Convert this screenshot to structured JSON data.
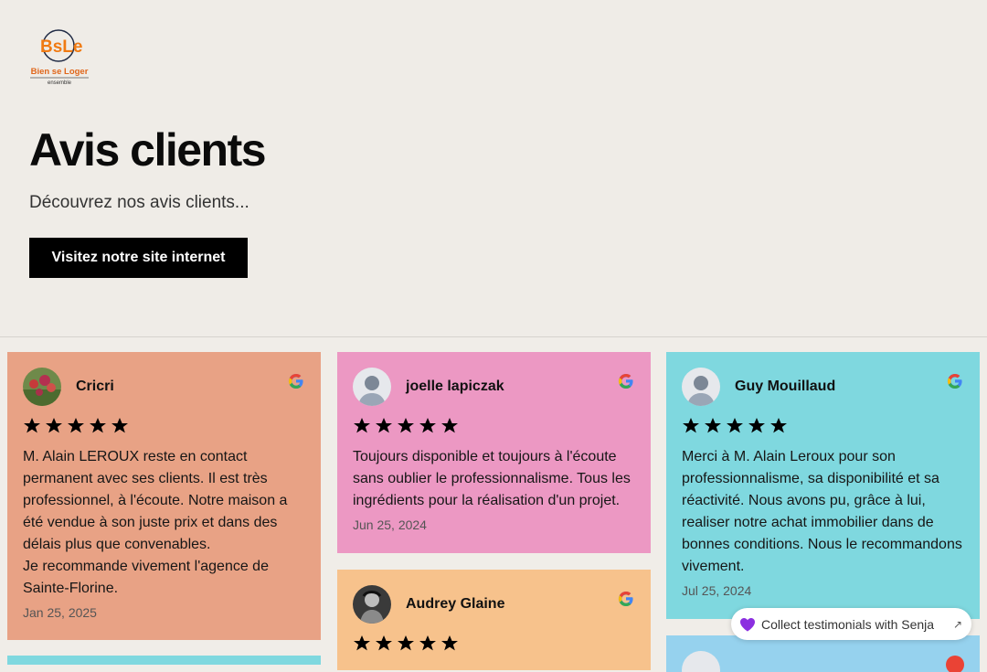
{
  "header": {
    "logo_text": "BsLe",
    "logo_line1": "Bien se Loger",
    "logo_line2": "ensemble",
    "title": "Avis clients",
    "subtitle": "Découvrez nos avis clients...",
    "cta_label": "Visitez notre site internet"
  },
  "reviews": [
    {
      "name": "Cricri",
      "rating": 5,
      "text": "M. Alain LEROUX reste en contact permanent avec ses clients. Il est très professionnel, à l'écoute. Notre maison a été vendue à son juste prix et dans des délais plus que convenables.\nJe recommande vivement l'agence de Sainte-Florine.",
      "date": "Jan 25, 2025",
      "bg_color": "#e8a285",
      "avatar": "photo"
    },
    {
      "name": "joelle lapiczak",
      "rating": 5,
      "text": "Toujours disponible et toujours à l'écoute sans oublier le professionnalisme. Tous les ingrédients pour la réalisation d'un projet.",
      "date": "Jun 25, 2024",
      "bg_color": "#ec98c3",
      "avatar": "default-avatar"
    },
    {
      "name": "Guy Mouillaud",
      "rating": 5,
      "text": "Merci à M. Alain Leroux pour son professionnalisme, sa disponibilité et sa réactivité. Nous avons pu, grâce à lui, realiser notre achat immobilier dans de bonnes conditions. Nous le recommandons vivement.",
      "date": "Jul 25, 2024",
      "bg_color": "#7fd8df",
      "avatar": "default-avatar"
    },
    {
      "name": "Audrey Glaine",
      "rating": 5,
      "text": "",
      "date": "",
      "bg_color": "#f7c28c",
      "avatar": "photo"
    }
  ],
  "source_icon": "google-icon",
  "senja_badge": {
    "label": "Collect testimonials with Senja",
    "icon": "heart-icon",
    "accent": "#8b2fe0"
  }
}
